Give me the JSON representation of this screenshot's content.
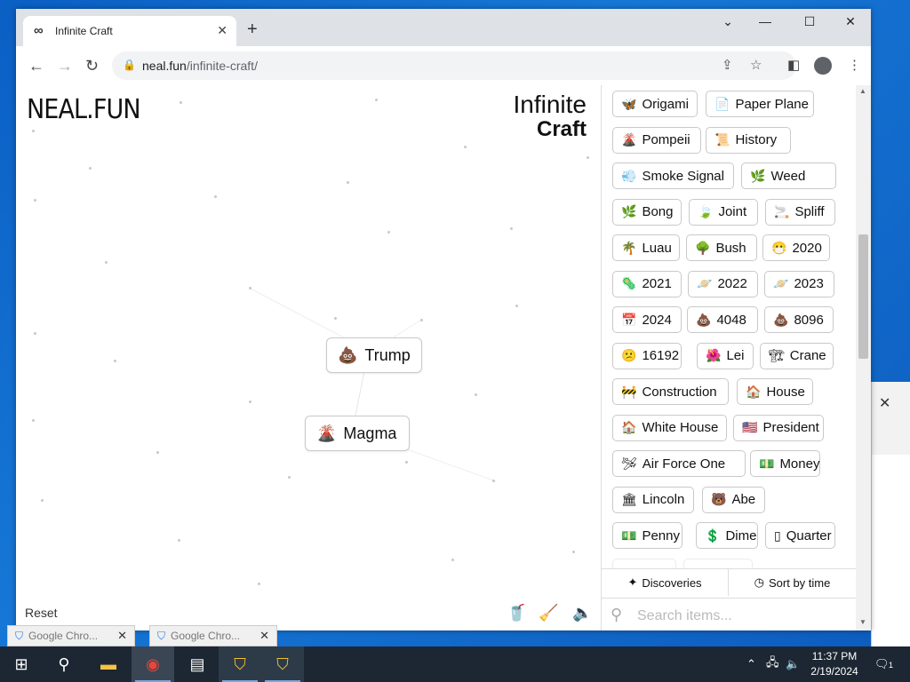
{
  "browser": {
    "tab_title": "Infinite Craft",
    "tab_icon": "∞",
    "url_host": "neal.fun",
    "url_path": "/infinite-craft/"
  },
  "page": {
    "logo": "NEAL.FUN",
    "title_line1": "Infinite",
    "title_line2": "Craft",
    "reset_label": "Reset",
    "canvas_items": [
      {
        "emoji": "💩",
        "label": "Trump"
      },
      {
        "emoji": "🌋",
        "label": "Magma"
      }
    ]
  },
  "sidebar": {
    "items": [
      {
        "emoji": "🦋",
        "label": "Origami"
      },
      {
        "emoji": "📄",
        "label": "Paper Plane"
      },
      {
        "emoji": "🌋",
        "label": "Pompeii"
      },
      {
        "emoji": "📜",
        "label": "History"
      },
      {
        "emoji": "💨",
        "label": "Smoke Signal"
      },
      {
        "emoji": "🌿",
        "label": "Weed"
      },
      {
        "emoji": "🌿",
        "label": "Bong"
      },
      {
        "emoji": "🍃",
        "label": "Joint"
      },
      {
        "emoji": "🚬",
        "label": "Spliff"
      },
      {
        "emoji": "🌴",
        "label": "Luau"
      },
      {
        "emoji": "🌳",
        "label": "Bush"
      },
      {
        "emoji": "😷",
        "label": "2020"
      },
      {
        "emoji": "🦠",
        "label": "2021"
      },
      {
        "emoji": "🪐",
        "label": "2022"
      },
      {
        "emoji": "🪐",
        "label": "2023"
      },
      {
        "emoji": "📅",
        "label": "2024"
      },
      {
        "emoji": "💩",
        "label": "4048"
      },
      {
        "emoji": "💩",
        "label": "8096"
      },
      {
        "emoji": "😕",
        "label": "16192"
      },
      {
        "emoji": "🌺",
        "label": "Lei"
      },
      {
        "emoji": "🏗",
        "label": "Crane"
      },
      {
        "emoji": "🚧",
        "label": "Construction"
      },
      {
        "emoji": "🏠",
        "label": "House"
      },
      {
        "emoji": "🏠",
        "label": "White House"
      },
      {
        "emoji": "🇺🇸",
        "label": "President"
      },
      {
        "emoji": "🛩",
        "label": "Air Force One"
      },
      {
        "emoji": "💵",
        "label": "Money"
      },
      {
        "emoji": "🏛",
        "label": "Lincoln"
      },
      {
        "emoji": "🐻",
        "label": "Abe"
      },
      {
        "emoji": "💵",
        "label": "Penny"
      },
      {
        "emoji": "💲",
        "label": "Dime"
      },
      {
        "emoji": "▯",
        "label": "Quarter"
      }
    ],
    "discoveries_label": "Discoveries",
    "sort_label": "Sort by time",
    "search_placeholder": "Search items..."
  },
  "taskbar": {
    "previews": [
      "Google Chro...",
      "Google Chro..."
    ],
    "time": "11:37 PM",
    "date": "2/19/2024",
    "notification_count": "1"
  }
}
